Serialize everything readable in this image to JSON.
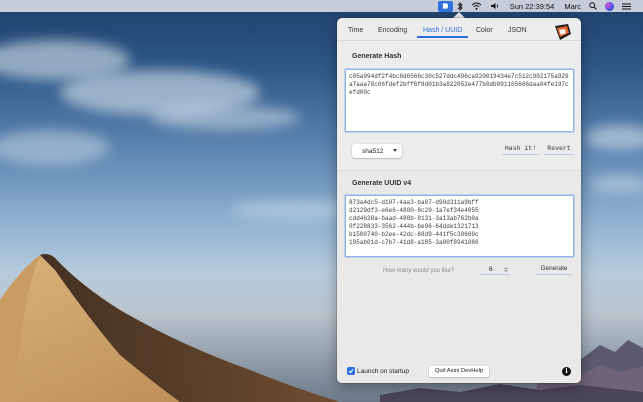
{
  "menubar": {
    "datetime": "Sun 22:39:54",
    "user": "Marc",
    "icons": [
      "devhelp-icon",
      "bluetooth-icon",
      "wifi-icon",
      "volume-icon",
      "search-icon",
      "siri-icon",
      "menu-list-icon"
    ]
  },
  "tabs": [
    {
      "label": "Time",
      "active": false
    },
    {
      "label": "Encoding",
      "active": false
    },
    {
      "label": "Hash / UUID",
      "active": true
    },
    {
      "label": "Color",
      "active": false
    },
    {
      "label": "JSON",
      "active": false
    }
  ],
  "hash": {
    "title": "Generate Hash",
    "output": "c05a994df2f4bc8d6566c30c527ddc496ca920019434e7c512c902175a929a7aaa78c06fdef2bff6f8d01b3a822052e477b0db091165666daa04fe197cefd00c",
    "algorithm": "sha512",
    "hash_button": "Hash it!",
    "revert_button": "Revert"
  },
  "uuid": {
    "title": "Generate UUID v4",
    "output": "873a4dc5-d107-4aa3-ba07-d90d311a9bff\nd2129df3-e6e6-4880-8c29-1a7ef34e4055\ncdd4638a-baad-488b-8131-3a13ab762b0a\n0f228833-3562-444b-be96-64dde1321713\nb1580740-b2ee-42dc-88d9-441f5c30669c\n195ab01d-c7b7-41d8-a185-3a00f8941080",
    "question": "How many would you like?",
    "count": "6",
    "generate_button": "Generate"
  },
  "footer": {
    "launch_label": "Launch on startup",
    "launch_checked": true,
    "quit_label": "Quit Asini DevHelp",
    "info_label": "i"
  },
  "colors": {
    "accent": "#2a6fe0",
    "panel_bg": "#ececec",
    "logo_orange": "#e8662a"
  }
}
